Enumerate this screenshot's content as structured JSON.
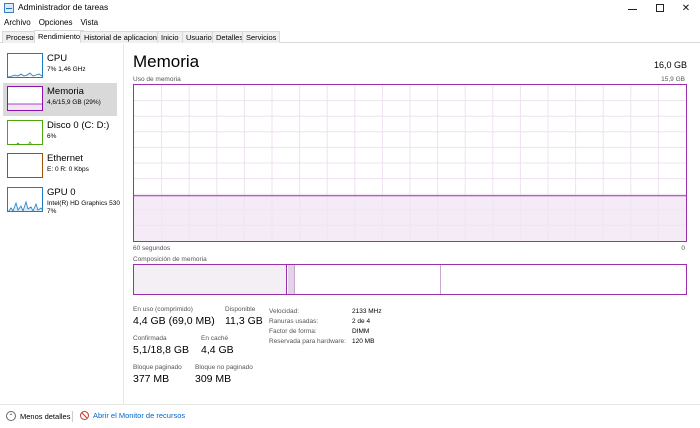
{
  "window": {
    "title": "Administrador de tareas"
  },
  "menu": [
    "Archivo",
    "Opciones",
    "Vista"
  ],
  "tabs": [
    "Procesos",
    "Rendimiento",
    "Historial de aplicaciones",
    "Inicio",
    "Usuarios",
    "Detalles",
    "Servicios"
  ],
  "active_tab": "Rendimiento",
  "sidebar": [
    {
      "name": "CPU",
      "sub": "7% 1,46 GHz",
      "color": "#1f7ec2",
      "active": false
    },
    {
      "name": "Memoria",
      "sub": "4,6/15,9 GB (29%)",
      "color": "#8b12ae",
      "active": true
    },
    {
      "name": "Disco 0 (C: D:)",
      "sub": "6%",
      "color": "#4da60c",
      "active": false
    },
    {
      "name": "Ethernet",
      "sub": "E: 0 R: 0 Kbps",
      "color": "#a74f01",
      "active": false
    },
    {
      "name": "GPU 0",
      "sub": "Intel(R) HD Graphics 530",
      "sub2": "7%",
      "color": "#1f7ec2",
      "active": false
    }
  ],
  "main": {
    "title": "Memoria",
    "total": "16,0 GB",
    "graph_label": "Uso de memoria",
    "graph_max": "15,9 GB",
    "axis_left": "60 segundos",
    "axis_right": "0",
    "composition_label": "Composición de memoria",
    "usage_fraction": 0.29,
    "accent_color": "#9b2fae"
  },
  "stats": {
    "in_use_label": "En uso (comprimido)",
    "in_use_value": "4,4 GB (69,0 MB)",
    "available_label": "Disponible",
    "available_value": "11,3 GB",
    "committed_label": "Confirmada",
    "committed_value": "5,1/18,8 GB",
    "cached_label": "En caché",
    "cached_value": "4,4 GB",
    "paged_label": "Bloque paginado",
    "paged_value": "377 MB",
    "nonpaged_label": "Bloque no paginado",
    "nonpaged_value": "309 MB"
  },
  "properties": [
    {
      "key": "Velocidad:",
      "value": "2133 MHz"
    },
    {
      "key": "Ranuras usadas:",
      "value": "2 de 4"
    },
    {
      "key": "Factor de forma:",
      "value": "DIMM"
    },
    {
      "key": "Reservada para hardware:",
      "value": "120 MB"
    }
  ],
  "footer": {
    "fewer_details": "Menos detalles",
    "resource_monitor": "Abrir el Monitor de recursos"
  }
}
